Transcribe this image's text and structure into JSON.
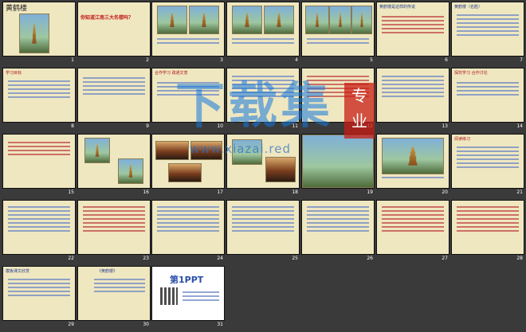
{
  "watermark": {
    "main": "下载集",
    "seal": "专业",
    "url": "www.xiazai.red"
  },
  "slides": [
    {
      "num": "1",
      "title": "黄鹤楼"
    },
    {
      "num": "2",
      "title": "你知道江南三大名楼吗？"
    },
    {
      "num": "3",
      "title": ""
    },
    {
      "num": "4",
      "title": ""
    },
    {
      "num": "5",
      "title": ""
    },
    {
      "num": "6",
      "title": "黄鹤楼是这样的传说"
    },
    {
      "num": "7",
      "title": "黄鹤楼（名胜）"
    },
    {
      "num": "8",
      "title": "学习目标"
    },
    {
      "num": "9",
      "title": ""
    },
    {
      "num": "10",
      "title": "合作学习 疏通文意"
    },
    {
      "num": "11",
      "title": ""
    },
    {
      "num": "12",
      "title": ""
    },
    {
      "num": "13",
      "title": ""
    },
    {
      "num": "14",
      "title": "探究学习 合作讨论"
    },
    {
      "num": "15",
      "title": ""
    },
    {
      "num": "16",
      "title": ""
    },
    {
      "num": "17",
      "title": ""
    },
    {
      "num": "18",
      "title": ""
    },
    {
      "num": "19",
      "title": ""
    },
    {
      "num": "20",
      "title": ""
    },
    {
      "num": "21",
      "title": "阅读练习"
    },
    {
      "num": "22",
      "title": ""
    },
    {
      "num": "23",
      "title": ""
    },
    {
      "num": "24",
      "title": ""
    },
    {
      "num": "25",
      "title": ""
    },
    {
      "num": "26",
      "title": ""
    },
    {
      "num": "27",
      "title": ""
    },
    {
      "num": "28",
      "title": ""
    },
    {
      "num": "29",
      "title": "模板课文欣赏"
    },
    {
      "num": "30",
      "title": "《黄鹤楼》"
    },
    {
      "num": "31",
      "title": "第1PPT"
    }
  ]
}
